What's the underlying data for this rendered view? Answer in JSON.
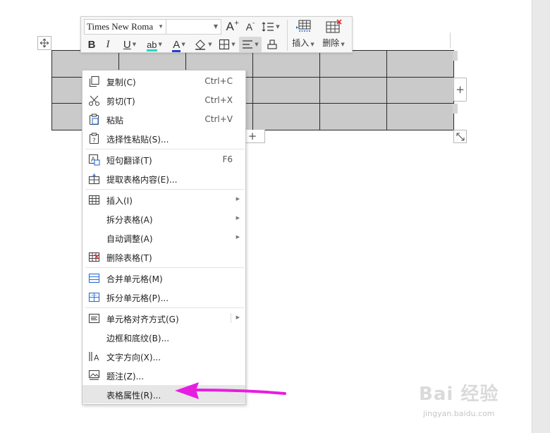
{
  "toolbar": {
    "font_name": "Times New Roma",
    "font_size": "",
    "bold": "B",
    "italic": "I",
    "underline": "U",
    "highlight": "ab",
    "font_color": "A",
    "grow_font": "A",
    "shrink_font": "A",
    "insert_label": "插入",
    "delete_label": "删除"
  },
  "table": {
    "rows": 3,
    "cols": 6
  },
  "buttons": {
    "add_column": "+",
    "add_row": "+"
  },
  "context_menu": {
    "items": [
      {
        "label": "复制(C)",
        "shortcut": "Ctrl+C",
        "icon": "copy-icon"
      },
      {
        "label": "剪切(T)",
        "shortcut": "Ctrl+X",
        "icon": "scissors-icon"
      },
      {
        "label": "粘贴",
        "shortcut": "Ctrl+V",
        "icon": "paste-icon"
      },
      {
        "label": "选择性粘贴(S)...",
        "shortcut": "",
        "icon": "paste-special-icon"
      },
      {
        "label": "短句翻译(T)",
        "shortcut": "F6",
        "icon": "translate-icon"
      },
      {
        "label": "提取表格内容(E)...",
        "shortcut": "",
        "icon": "extract-icon"
      },
      {
        "label": "插入(I)",
        "shortcut": "",
        "icon": "table-insert-icon",
        "submenu": true
      },
      {
        "label": "拆分表格(A)",
        "shortcut": "",
        "icon": "",
        "submenu": true
      },
      {
        "label": "自动调整(A)",
        "shortcut": "",
        "icon": "",
        "submenu": true
      },
      {
        "label": "删除表格(T)",
        "shortcut": "",
        "icon": "table-delete-icon"
      },
      {
        "label": "合并单元格(M)",
        "shortcut": "",
        "icon": "merge-cells-icon"
      },
      {
        "label": "拆分单元格(P)...",
        "shortcut": "",
        "icon": "split-cells-icon"
      },
      {
        "label": "单元格对齐方式(G)",
        "shortcut": "",
        "icon": "cell-align-icon",
        "submenu": true
      },
      {
        "label": "边框和底纹(B)...",
        "shortcut": "",
        "icon": ""
      },
      {
        "label": "文字方向(X)...",
        "shortcut": "",
        "icon": "text-direction-icon"
      },
      {
        "label": "题注(Z)...",
        "shortcut": "",
        "icon": "caption-icon"
      },
      {
        "label": "表格属性(R)...",
        "shortcut": "",
        "icon": "",
        "highlighted": true
      }
    ]
  },
  "watermark": {
    "main": "Bai 经验",
    "sub": "jingyan.baidu.com"
  },
  "colors": {
    "table_fill": "#cacaca",
    "annotation_arrow": "#e61ee0",
    "font_color_bar": "#1f3fd1",
    "highlight_bar": "#2bd4c4",
    "delete_x": "#e03030"
  }
}
